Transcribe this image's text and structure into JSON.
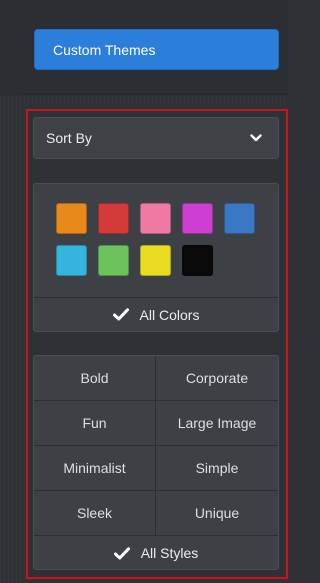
{
  "custom_themes": {
    "label": "Custom Themes",
    "color": "#2b7fdb"
  },
  "sort": {
    "label": "Sort By",
    "icon": "chevron-down-icon"
  },
  "colors": {
    "swatches": [
      {
        "name": "orange",
        "hex": "#e8891a"
      },
      {
        "name": "red",
        "hex": "#d43a3a"
      },
      {
        "name": "pink",
        "hex": "#ee7aa4"
      },
      {
        "name": "magenta",
        "hex": "#cc3fd0"
      },
      {
        "name": "blue",
        "hex": "#3a78c4"
      },
      {
        "name": "cyan",
        "hex": "#35b5dd"
      },
      {
        "name": "green",
        "hex": "#6cc35c"
      },
      {
        "name": "yellow",
        "hex": "#eadc23"
      },
      {
        "name": "black",
        "hex": "#0a0a0a"
      }
    ],
    "all_label": "All Colors",
    "all_icon": "check-icon"
  },
  "styles": {
    "items": [
      "Bold",
      "Corporate",
      "Fun",
      "Large Image",
      "Minimalist",
      "Simple",
      "Sleek",
      "Unique"
    ],
    "all_label": "All Styles",
    "all_icon": "check-icon"
  },
  "highlight_color": "#d0101a"
}
